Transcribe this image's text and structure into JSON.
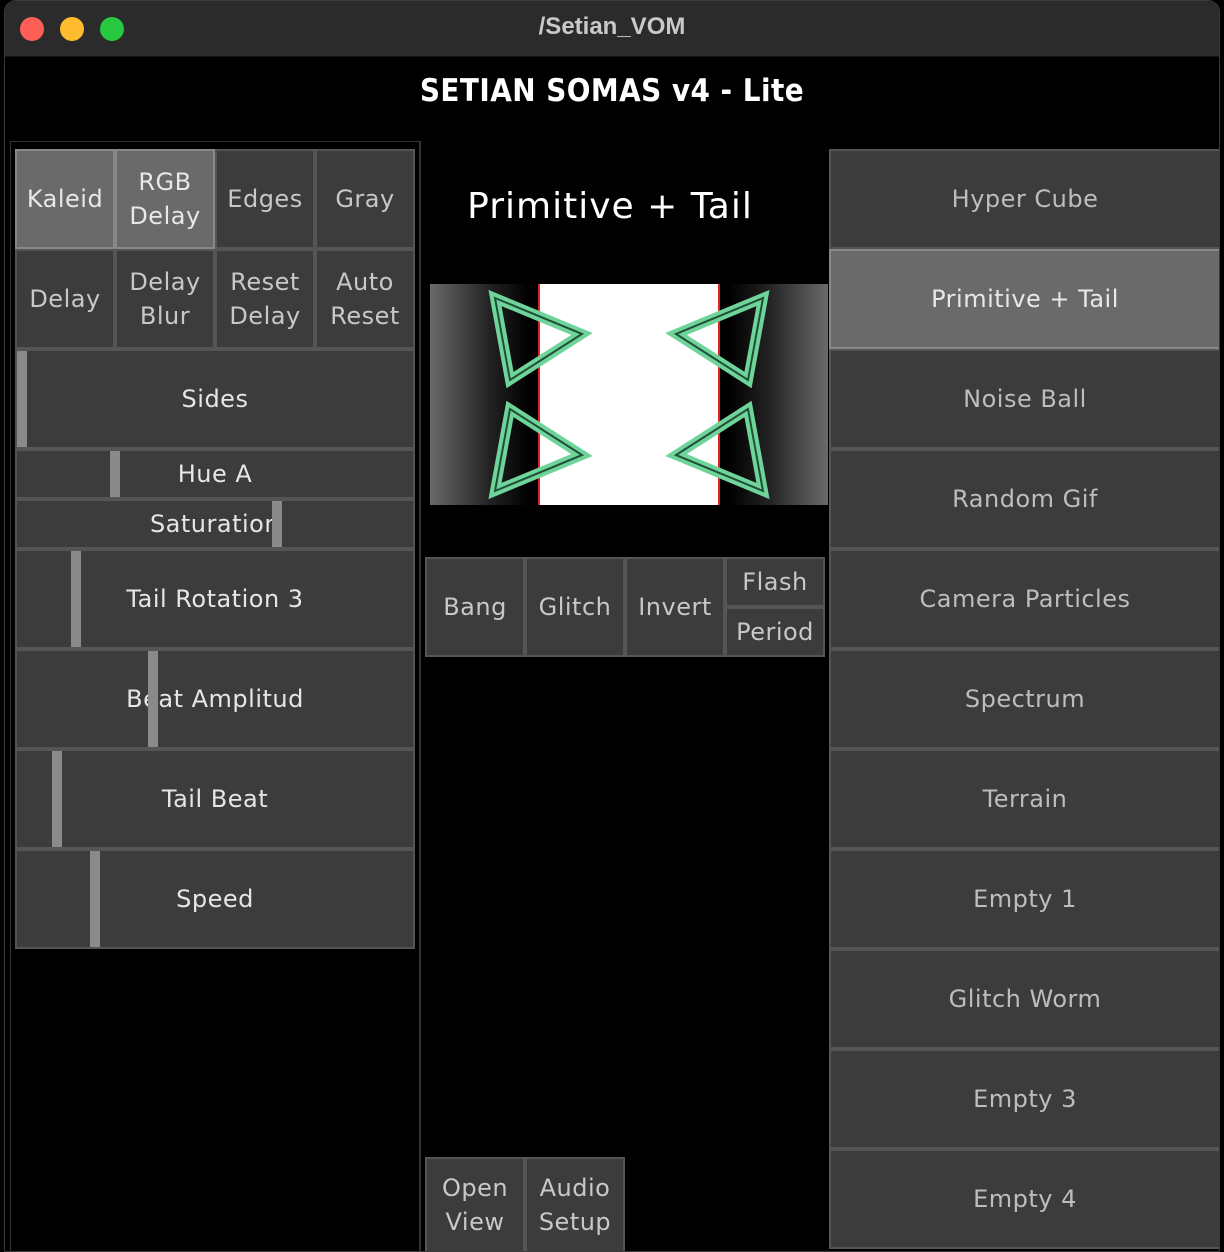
{
  "window": {
    "title": "/Setian_VOM"
  },
  "app": {
    "title": "SETIAN SOMAS v4 - Lite"
  },
  "effects": {
    "row1": [
      {
        "label": "Kaleid",
        "active": true
      },
      {
        "label": "RGB\nDelay",
        "active": true
      },
      {
        "label": "Edges",
        "active": false
      },
      {
        "label": "Gray",
        "active": false
      }
    ],
    "row2": [
      {
        "label": "Delay"
      },
      {
        "label": "Delay\nBlur"
      },
      {
        "label": "Reset\nDelay"
      },
      {
        "label": "Auto\nReset"
      }
    ]
  },
  "sliders": [
    {
      "label": "Sides",
      "value": 0.0
    },
    {
      "label": "Hue A",
      "value": 0.24
    },
    {
      "label": "Saturation",
      "value": 0.66
    },
    {
      "label": "Tail Rotation 3",
      "value": 0.14
    },
    {
      "label": "Beat Amplitud",
      "value": 0.34
    },
    {
      "label": "Tail Beat",
      "value": 0.09
    },
    {
      "label": "Speed",
      "value": 0.19
    }
  ],
  "preview": {
    "title": "Primitive + Tail"
  },
  "fx_buttons": {
    "bang": "Bang",
    "glitch": "Glitch",
    "invert": "Invert",
    "flash": "Flash",
    "period": "Period"
  },
  "bottom_buttons": {
    "open_view": "Open\nView",
    "audio_setup": "Audio\nSetup"
  },
  "scenes": [
    {
      "label": "Hyper Cube",
      "active": false
    },
    {
      "label": "Primitive + Tail",
      "active": true
    },
    {
      "label": "Noise Ball",
      "active": false
    },
    {
      "label": "Random Gif",
      "active": false
    },
    {
      "label": "Camera Particles",
      "active": false
    },
    {
      "label": "Spectrum",
      "active": false
    },
    {
      "label": "Terrain",
      "active": false
    },
    {
      "label": "Empty 1",
      "active": false
    },
    {
      "label": "Glitch Worm",
      "active": false
    },
    {
      "label": "Empty 3",
      "active": false
    },
    {
      "label": "Empty 4",
      "active": false
    }
  ],
  "colors": {
    "button_bg": "#3c3c3c",
    "button_active": "#6a6a6a",
    "handle": "#8a8a8a",
    "accent_green": "#6fd49a"
  }
}
